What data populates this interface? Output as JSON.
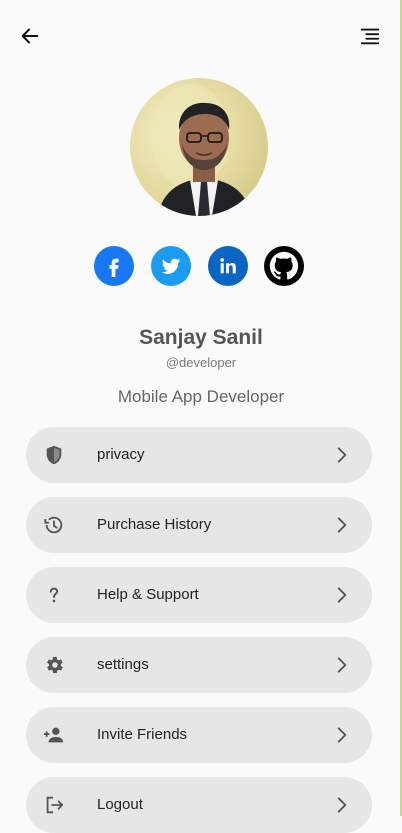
{
  "profile": {
    "name": "Sanjay Sanil",
    "handle": "@developer",
    "role": "Mobile App Developer"
  },
  "socials": [
    {
      "name": "Facebook",
      "icon": "facebook-icon",
      "color": "#1877f2"
    },
    {
      "name": "Twitter",
      "icon": "twitter-icon",
      "color": "#1d9bf0"
    },
    {
      "name": "LinkedIn",
      "icon": "linkedin-icon",
      "color": "#0a66c2"
    },
    {
      "name": "GitHub",
      "icon": "github-icon",
      "color": "#000000"
    }
  ],
  "menu": [
    {
      "label": "privacy",
      "icon": "shield-icon"
    },
    {
      "label": "Purchase History",
      "icon": "history-icon"
    },
    {
      "label": "Help & Support",
      "icon": "question-icon"
    },
    {
      "label": "settings",
      "icon": "gear-icon"
    },
    {
      "label": "Invite Friends",
      "icon": "add-person-icon"
    },
    {
      "label": "Logout",
      "icon": "logout-icon"
    }
  ],
  "colors": {
    "background": "#fafafa",
    "menu_item": "#e6e6e6",
    "icon": "#555555"
  }
}
